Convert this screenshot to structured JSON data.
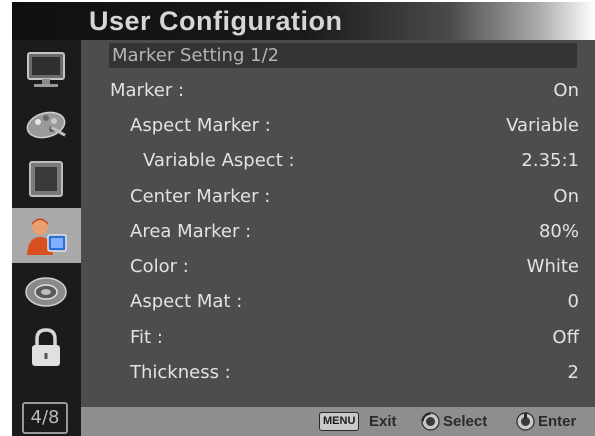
{
  "header": {
    "title": "User Configuration"
  },
  "sidebar": {
    "items": [
      {
        "icon": "monitor-icon",
        "active": false
      },
      {
        "icon": "palette-icon",
        "active": false
      },
      {
        "icon": "screen-frame-icon",
        "active": false
      },
      {
        "icon": "user-config-icon",
        "active": true
      },
      {
        "icon": "dial-icon",
        "active": false
      },
      {
        "icon": "lock-icon",
        "active": false
      }
    ],
    "page_indicator": "4/8"
  },
  "menu": {
    "section_title": "Marker Setting 1/2",
    "items": [
      {
        "label": "Marker :",
        "value": "On",
        "indent": 0
      },
      {
        "label": "Aspect Marker :",
        "value": "Variable",
        "indent": 1
      },
      {
        "label": "Variable Aspect :",
        "value": "2.35:1",
        "indent": 2
      },
      {
        "label": "Center Marker :",
        "value": "On",
        "indent": 1
      },
      {
        "label": "Area Marker :",
        "value": "80%",
        "indent": 1
      },
      {
        "label": "Color :",
        "value": "White",
        "indent": 1
      },
      {
        "label": "Aspect Mat :",
        "value": "0",
        "indent": 1
      },
      {
        "label": "Fit :",
        "value": "Off",
        "indent": 1
      },
      {
        "label": "Thickness :",
        "value": "2",
        "indent": 1
      }
    ]
  },
  "footer": {
    "menu_key": "MENU",
    "exit_label": "Exit",
    "select_label": "Select",
    "enter_label": "Enter"
  },
  "colors": {
    "panel_bg": "#4d4d4d",
    "sidebar_bg": "#1b1b1b",
    "active_item_bg": "#a9a9a9",
    "footer_bg": "#8e8e8e",
    "text": "#e2e2e2"
  }
}
